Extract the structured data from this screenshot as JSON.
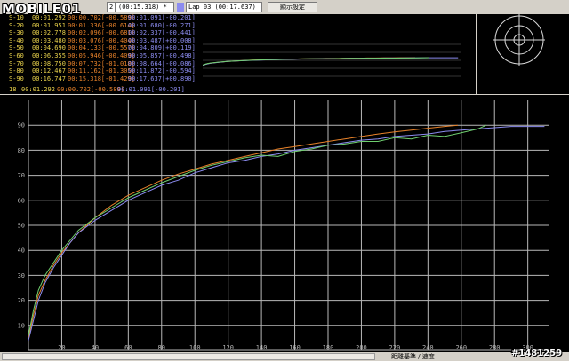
{
  "toolbar": {
    "lap_a_label": "(00:15.318) *",
    "lap_a_prefix": "2",
    "lap_b_label": "Lap 03  (00:17.637)",
    "display_button": "顯示設定",
    "lap_a_color": "#e8822a",
    "lap_b_color": "#8c8cf0"
  },
  "logo_text": "MOBILE01",
  "splits": [
    {
      "label": "S-10",
      "time": "00:01.292",
      "a": "00:00.702[-00.589]",
      "b": "00:01.091[-00.201]"
    },
    {
      "label": "S-20",
      "time": "00:01.951",
      "a": "00:01.336[-00.614]",
      "b": "00:01.680[-00.271]"
    },
    {
      "label": "S-30",
      "time": "00:02.778",
      "a": "00:02.096[-00.681]",
      "b": "00:02.337[-00.441]"
    },
    {
      "label": "S-40",
      "time": "00:03.480",
      "a": "00:03.076[-00.404]",
      "b": "00:03.487[+00.008]"
    },
    {
      "label": "S-50",
      "time": "00:04.690",
      "a": "00:04.133[-00.557]",
      "b": "00:04.809[+00.119]"
    },
    {
      "label": "S-60",
      "time": "00:06.355",
      "a": "00:05.946[-00.409]",
      "b": "00:05.857[-00.498]"
    },
    {
      "label": "S-70",
      "time": "00:08.750",
      "a": "00:07.732[-01.018]",
      "b": "00:08.664[-00.086]"
    },
    {
      "label": "S-80",
      "time": "00:12.467",
      "a": "00:11.162[-01.305]",
      "b": "00:11.872[-00.594]"
    },
    {
      "label": "S-90",
      "time": "00:16.747",
      "a": "00:15.318[-01.429]",
      "b": "00:17.637[+00.890]"
    }
  ],
  "footer": {
    "label": "18",
    "time": "00:01.292",
    "a": "00:00.702[-00.589]",
    "b": "00:01.091[-00.201]"
  },
  "chart_data": {
    "type": "line",
    "xlabel": "距離基準 / 速度",
    "xticks": [
      "20",
      "40",
      "60",
      "80",
      "100",
      "120",
      "140",
      "160",
      "180",
      "200",
      "220",
      "240",
      "260",
      "280",
      "300"
    ],
    "yticks": [
      "10",
      "20",
      "30",
      "40",
      "50",
      "60",
      "70",
      "80",
      "90"
    ],
    "xlim": [
      0,
      313
    ],
    "ylim": [
      0,
      100
    ],
    "series": [
      {
        "color": "#e8822a",
        "x": [
          0,
          3,
          6,
          10,
          15,
          20,
          25,
          30,
          40,
          50,
          60,
          70,
          80,
          90,
          100,
          110,
          120,
          130,
          140,
          150,
          160,
          170,
          180,
          190,
          200,
          210,
          220,
          230,
          240,
          250,
          258
        ],
        "y": [
          5,
          14,
          22,
          28,
          34,
          39,
          43,
          47,
          53,
          58,
          62,
          65,
          68,
          70.5,
          72.5,
          74.5,
          76,
          77.5,
          79,
          80.5,
          81.5,
          82.5,
          83.5,
          84.5,
          85.5,
          86.5,
          87.3,
          88,
          88.8,
          89.5,
          90
        ]
      },
      {
        "color": "#8c8cf0",
        "x": [
          0,
          3,
          6,
          10,
          15,
          20,
          25,
          30,
          40,
          50,
          60,
          70,
          80,
          90,
          100,
          110,
          120,
          130,
          140,
          150,
          160,
          170,
          180,
          190,
          200,
          210,
          220,
          230,
          240,
          250,
          260,
          270,
          280,
          290,
          300,
          310
        ],
        "y": [
          4,
          12,
          20,
          27,
          33,
          38,
          43,
          47,
          52,
          56,
          60,
          63,
          66,
          68,
          71,
          73,
          75,
          76,
          77.5,
          78.5,
          80,
          81,
          82,
          83,
          84,
          84.5,
          85.5,
          86,
          86.5,
          87.5,
          88,
          88.5,
          89,
          89.5,
          89.5,
          89.5
        ]
      },
      {
        "color": "#6fcf6f",
        "x": [
          0,
          3,
          6,
          10,
          15,
          20,
          25,
          30,
          40,
          50,
          60,
          70,
          80,
          90,
          100,
          110,
          120,
          130,
          140,
          150,
          160,
          170,
          180,
          190,
          200,
          210,
          220,
          230,
          240,
          250,
          260,
          270,
          275
        ],
        "y": [
          6,
          16,
          24,
          30,
          35,
          40,
          44,
          48,
          53,
          57,
          61,
          64,
          67,
          69.5,
          72,
          74,
          75.5,
          77,
          78,
          77.5,
          79.5,
          80.5,
          82,
          82.5,
          83.5,
          83.5,
          85,
          84.5,
          86,
          85.5,
          87,
          88.5,
          90
        ]
      }
    ]
  },
  "colors": {
    "grid": "#b9b9b9",
    "background": "#000000",
    "label": "#e9d24b"
  },
  "watermark": "#1481259"
}
